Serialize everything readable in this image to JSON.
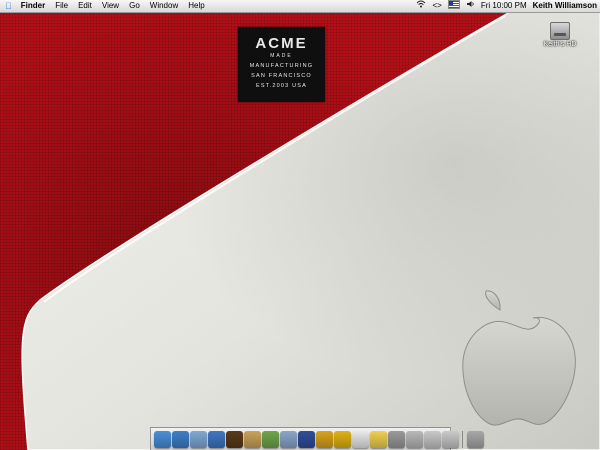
{
  "menubar": {
    "apple_icon": "apple-icon",
    "items": [
      "Finder",
      "File",
      "Edit",
      "View",
      "Go",
      "Window",
      "Help"
    ],
    "status": {
      "wifi_icon": "wifi-icon",
      "sync_icon": "sync-icon",
      "flag_icon": "us-flag-icon",
      "volume_icon": "volume-icon",
      "clock": "Fri 10:00 PM",
      "user": "Keith Williamson"
    }
  },
  "acme_label": {
    "brand": "ACME",
    "sub": "MADE",
    "line1": "MANUFACTURING",
    "line2": "SAN FRANCISCO",
    "line3": "EST.2003   USA"
  },
  "desktop_icon": {
    "label": "Keith's HD",
    "icon": "hard-drive-icon"
  },
  "dock": {
    "icons": [
      {
        "name": "finder-icon",
        "color": "#4a8fd8"
      },
      {
        "name": "safari-icon",
        "color": "#3d7fc9"
      },
      {
        "name": "mail-icon",
        "color": "#7fa9d6"
      },
      {
        "name": "ichat-icon",
        "color": "#3f77c2"
      },
      {
        "name": "sherlock-icon",
        "color": "#5a3a1a"
      },
      {
        "name": "address-book-icon",
        "color": "#caa25a"
      },
      {
        "name": "itunes-icon",
        "color": "#6fa64a"
      },
      {
        "name": "iphoto-icon",
        "color": "#8ba6c9"
      },
      {
        "name": "imovie-icon",
        "color": "#2f4f9a"
      },
      {
        "name": "idvd-icon",
        "color": "#d9a21b"
      },
      {
        "name": "sunflower-icon",
        "color": "#e0b315"
      },
      {
        "name": "ical-icon",
        "color": "#e9e9e9"
      },
      {
        "name": "stickies-icon",
        "color": "#f0d050"
      },
      {
        "name": "system-preferences-icon",
        "color": "#9a9a9a"
      },
      {
        "name": "sync-icon",
        "color": "#b8b8b8"
      },
      {
        "name": "documents-icon",
        "color": "#c8c8c8"
      },
      {
        "name": "downloads-icon",
        "color": "#c9c9c9"
      },
      {
        "name": "trash-icon",
        "color": "#a8a8a8"
      }
    ]
  }
}
